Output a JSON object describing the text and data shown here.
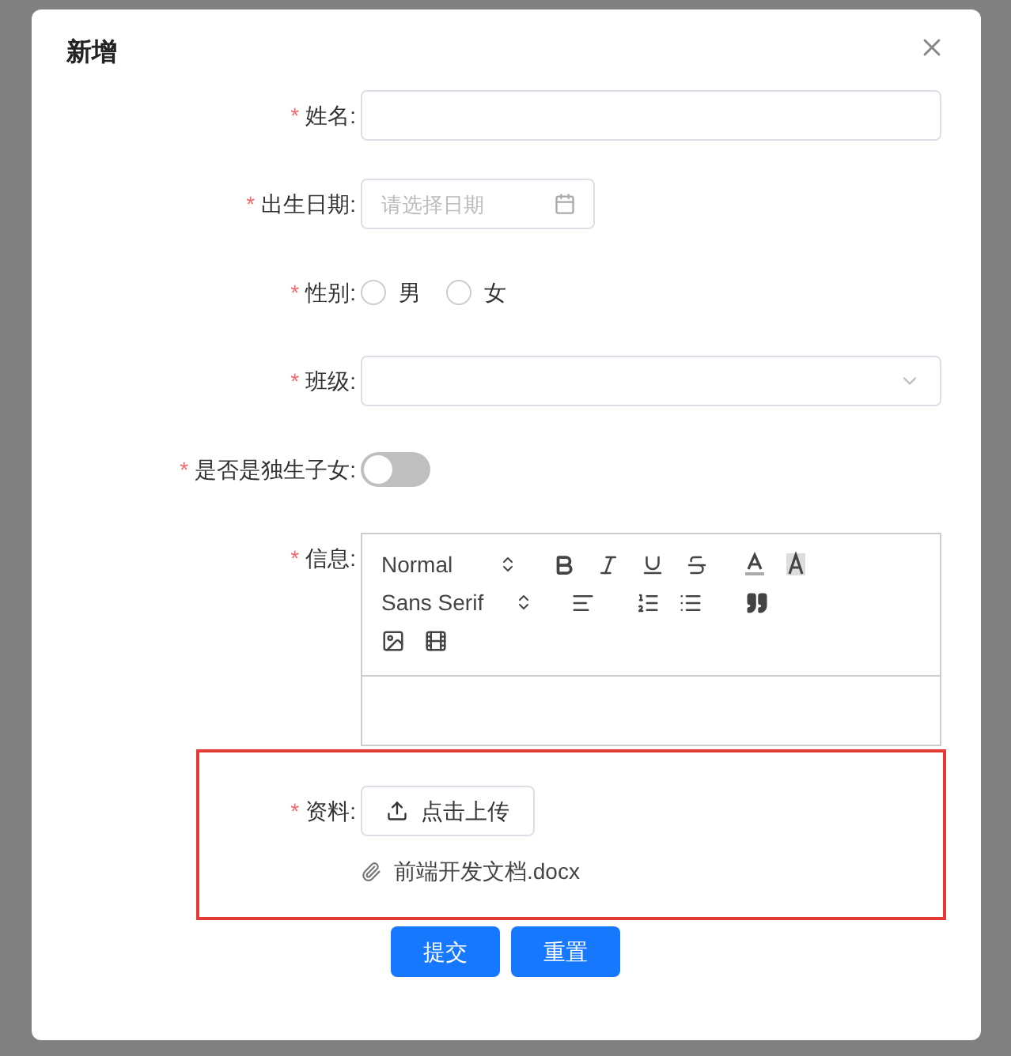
{
  "dialog": {
    "title": "新增"
  },
  "required_mark": "*",
  "fields": [
    {
      "kind": "text",
      "label": "姓名:",
      "required": true
    },
    {
      "kind": "date",
      "label": "出生日期:",
      "required": true,
      "placeholder": "请选择日期"
    },
    {
      "kind": "radio",
      "label": "性别:",
      "required": true,
      "options": [
        {
          "label": "男",
          "selected": false
        },
        {
          "label": "女",
          "selected": false
        }
      ]
    },
    {
      "kind": "select",
      "label": "班级:",
      "required": true
    },
    {
      "kind": "switch",
      "label": "是否是独生子女:",
      "required": true,
      "on": false
    },
    {
      "kind": "editor",
      "label": "信息:",
      "required": true,
      "header": "Normal",
      "font": "Sans Serif"
    },
    {
      "kind": "upload",
      "label": "资料:",
      "required": true,
      "highlighted": true,
      "button": "点击上传",
      "files": [
        "前端开发文档.docx"
      ]
    }
  ],
  "buttons": [
    {
      "label": "提交",
      "kind": "primary"
    },
    {
      "label": "重置",
      "kind": "primary"
    }
  ]
}
